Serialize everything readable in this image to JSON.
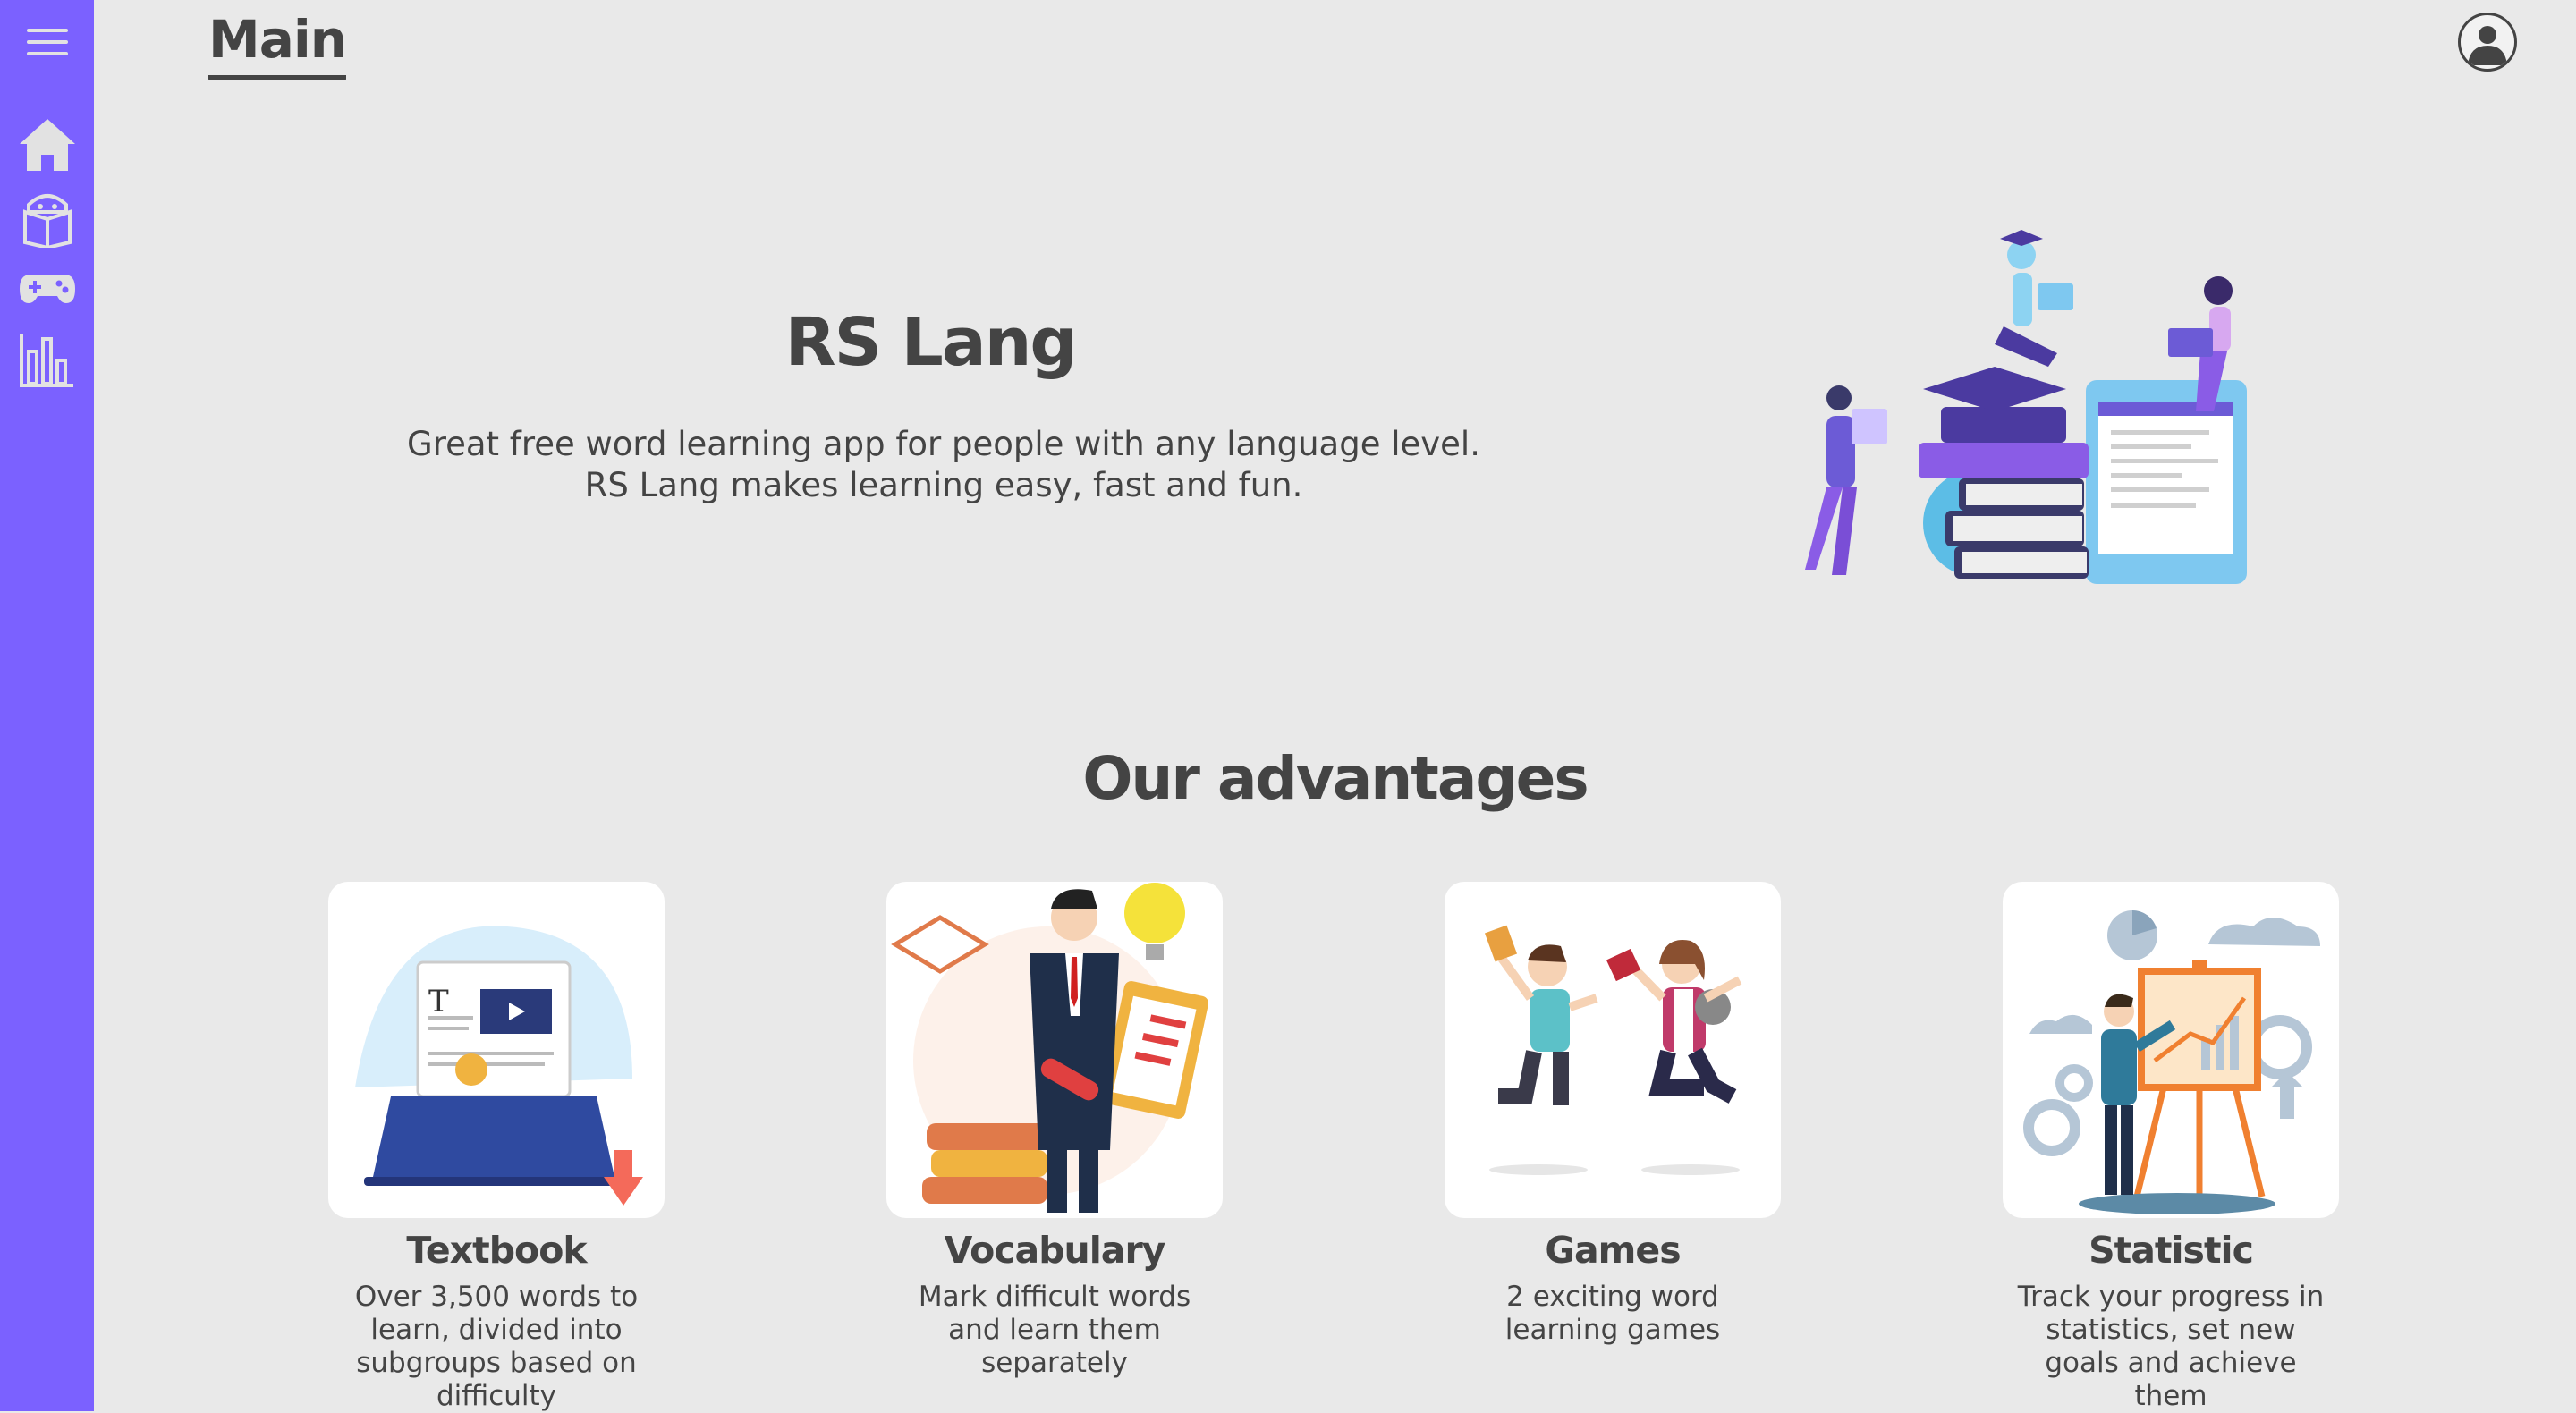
{
  "header": {
    "title": "Main"
  },
  "sidebar": {
    "items": [
      {
        "name": "menu",
        "icon": "hamburger-icon"
      },
      {
        "name": "main",
        "icon": "home-icon"
      },
      {
        "name": "textbook",
        "icon": "book-icon"
      },
      {
        "name": "games",
        "icon": "gamepad-icon"
      },
      {
        "name": "statistic",
        "icon": "bar-chart-icon"
      }
    ]
  },
  "hero": {
    "title": "RS Lang",
    "line1": "Great free word learning app for people with any language level.",
    "line2": "RS Lang makes learning easy, fast and fun."
  },
  "advantages": {
    "title": "Our advantages",
    "cards": [
      {
        "title": "Textbook",
        "description": "Over 3,500 words to learn, divided into subgroups based on difficulty"
      },
      {
        "title": "Vocabulary",
        "description": "Mark difficult words and learn them separately"
      },
      {
        "title": "Games",
        "description": "2 exciting word learning games"
      },
      {
        "title": "Statistic",
        "description": "Track your progress in statistics, set new goals and achieve them"
      }
    ]
  },
  "colors": {
    "accent": "#7b61ff",
    "background": "#e9e9e9",
    "text": "#444444",
    "icon": "#e2e2e2"
  }
}
